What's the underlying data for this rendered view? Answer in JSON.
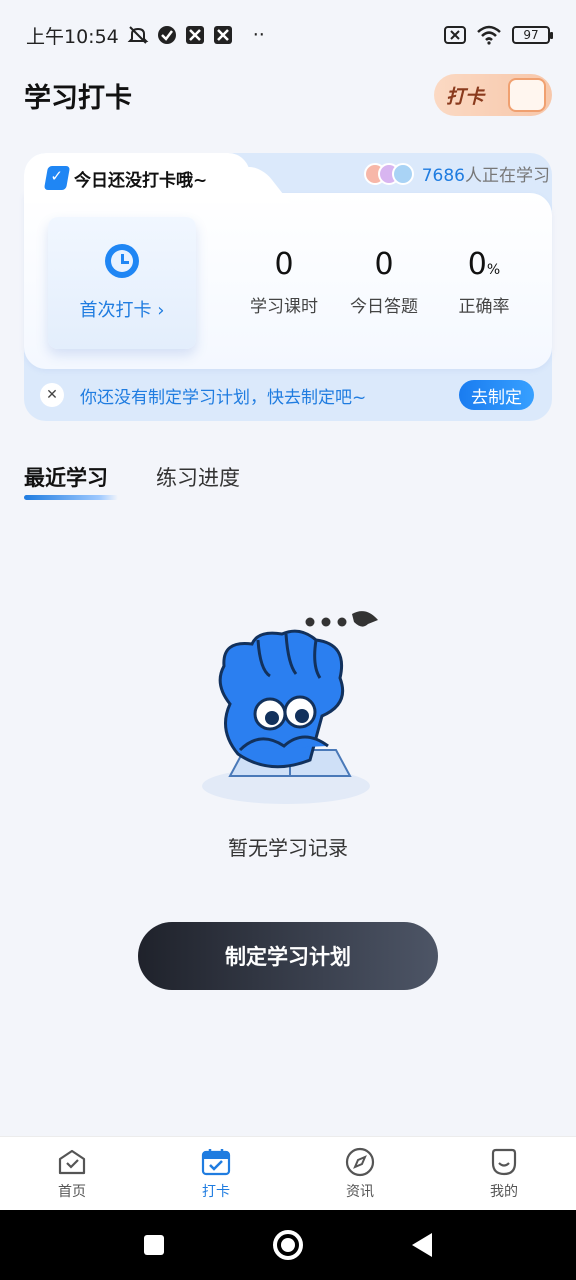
{
  "status_bar": {
    "time": "上午10:54",
    "dots": "··",
    "battery": "97"
  },
  "header": {
    "title": "学习打卡",
    "badge_label": "打卡"
  },
  "card": {
    "tab_label": "今日还没打卡哦~",
    "learners_count": "7686",
    "learners_suffix": "人正在学习",
    "first_checkin_label": "首次打卡 ›",
    "stats": [
      {
        "value": "0",
        "unit": "",
        "label": "学习课时"
      },
      {
        "value": "0",
        "unit": "",
        "label": "今日答题"
      },
      {
        "value": "0",
        "unit": "%",
        "label": "正确率"
      }
    ],
    "plan_text": "你还没有制定学习计划，快去制定吧~",
    "plan_button": "去制定"
  },
  "tabs": [
    {
      "label": "最近学习",
      "active": true
    },
    {
      "label": "练习进度",
      "active": false
    }
  ],
  "empty_state": {
    "message": "暂无学习记录",
    "cta_label": "制定学习计划"
  },
  "bottom_nav": [
    {
      "label": "首页",
      "icon": "home-icon",
      "active": false
    },
    {
      "label": "打卡",
      "icon": "calendar-check-icon",
      "active": true
    },
    {
      "label": "资讯",
      "icon": "compass-icon",
      "active": false
    },
    {
      "label": "我的",
      "icon": "profile-icon",
      "active": false
    }
  ],
  "colors": {
    "accent": "#1f7ce0",
    "background": "#f3f5fa",
    "cta_dark": "#1f222b"
  }
}
